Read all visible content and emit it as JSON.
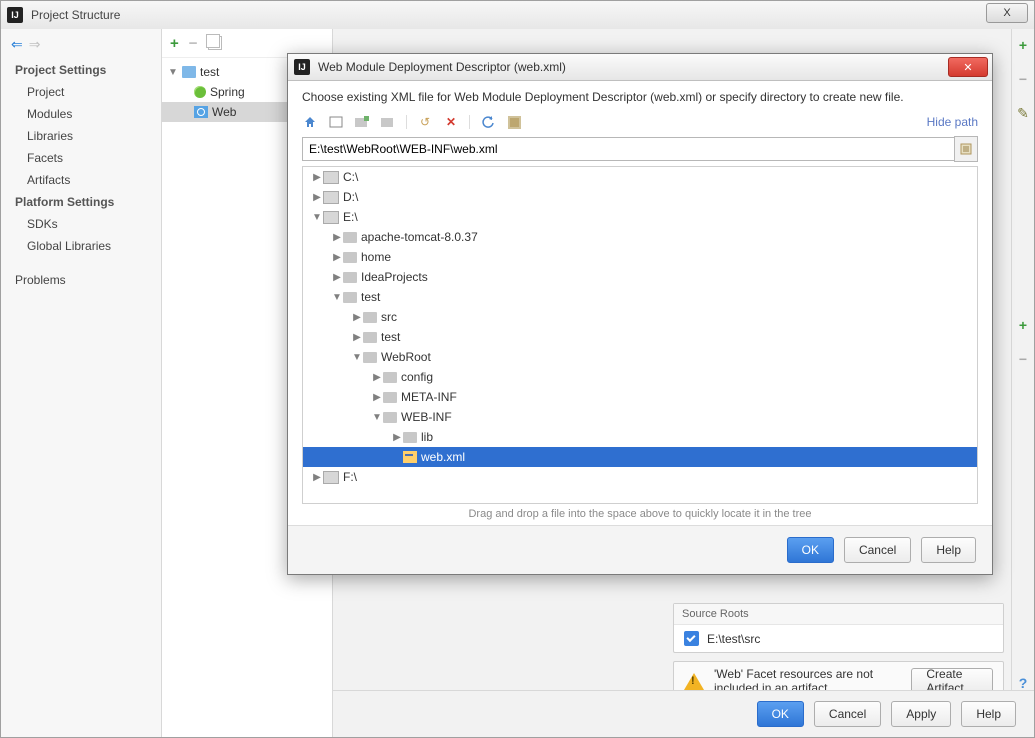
{
  "window": {
    "title": "Project Structure",
    "close_symbol": "X"
  },
  "sidebar": {
    "heading1": "Project Settings",
    "items1": [
      "Project",
      "Modules",
      "Libraries",
      "Facets",
      "Artifacts"
    ],
    "heading2": "Platform Settings",
    "items2": [
      "SDKs",
      "Global Libraries"
    ],
    "problems": "Problems"
  },
  "midtree": {
    "root": "test",
    "spring": "Spring",
    "web": "Web"
  },
  "rightside": {
    "source_header": "Source Roots",
    "source_path": "E:\\test\\src",
    "warn_text": "'Web' Facet resources are not included in an artifact",
    "create_artifact": "Create Artifact"
  },
  "buttons": {
    "ok": "OK",
    "cancel": "Cancel",
    "apply": "Apply",
    "help": "Help"
  },
  "dialog": {
    "title": "Web Module Deployment Descriptor (web.xml)",
    "instruction": "Choose existing XML file for Web Module Deployment Descriptor (web.xml) or specify directory to create new file.",
    "hide_path": "Hide path",
    "path": "E:\\test\\WebRoot\\WEB-INF\\web.xml",
    "drop_hint": "Drag and drop a file into the space above to quickly locate it in the tree",
    "tree": {
      "c": "C:\\",
      "d": "D:\\",
      "e": "E:\\",
      "f": "F:\\",
      "tomcat": "apache-tomcat-8.0.37",
      "home": "home",
      "ideap": "IdeaProjects",
      "test": "test",
      "src": "src",
      "test2": "test",
      "webroot": "WebRoot",
      "config": "config",
      "metainf": "META-INF",
      "webinf": "WEB-INF",
      "lib": "lib",
      "webxml": "web.xml"
    },
    "ok": "OK",
    "cancel": "Cancel",
    "help": "Help"
  }
}
